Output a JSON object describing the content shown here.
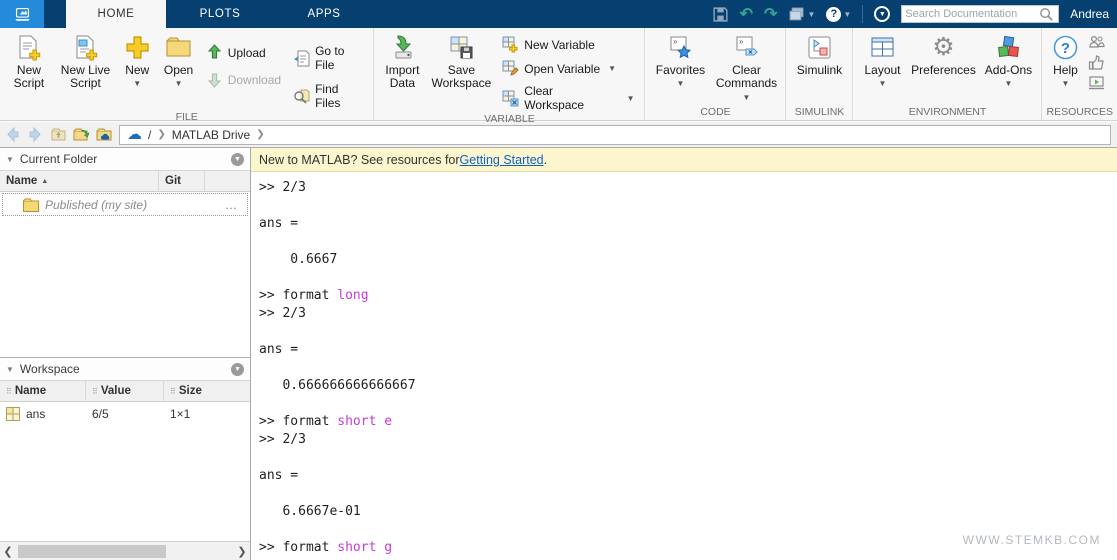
{
  "header": {
    "tabs": [
      {
        "label": "HOME"
      },
      {
        "label": "PLOTS"
      },
      {
        "label": "APPS"
      }
    ],
    "search_placeholder": "Search Documentation",
    "user_name": "Andrea"
  },
  "ribbon": {
    "file": {
      "label": "FILE",
      "new_script": "New Script",
      "new_live_script": "New Live Script",
      "new": "New",
      "open": "Open",
      "upload": "Upload",
      "download": "Download",
      "go_to_file": "Go to File",
      "find_files": "Find Files"
    },
    "variable": {
      "label": "VARIABLE",
      "import_data": "Import Data",
      "save_workspace": "Save Workspace",
      "new_variable": "New Variable",
      "open_variable": "Open Variable",
      "clear_workspace": "Clear Workspace"
    },
    "code": {
      "label": "CODE",
      "favorites": "Favorites",
      "clear_commands": "Clear Commands"
    },
    "simulink": {
      "label": "SIMULINK",
      "simulink": "Simulink"
    },
    "environment": {
      "label": "ENVIRONMENT",
      "layout": "Layout",
      "preferences": "Preferences",
      "addons": "Add-Ons"
    },
    "resources": {
      "label": "RESOURCES",
      "help": "Help"
    }
  },
  "breadcrumb": {
    "root": "/",
    "path": "MATLAB Drive"
  },
  "current_folder": {
    "title": "Current Folder",
    "col_name": "Name",
    "col_git": "Git",
    "rows": [
      {
        "name": "Published",
        "suffix": "(my site)",
        "more": "…"
      }
    ]
  },
  "workspace": {
    "title": "Workspace",
    "col_name": "Name",
    "col_value": "Value",
    "col_size": "Size",
    "rows": [
      {
        "name": "ans",
        "value": "6/5",
        "size": "1×1"
      }
    ]
  },
  "notification": {
    "text": "New to MATLAB? See resources for ",
    "link": "Getting Started",
    "period": "."
  },
  "console": {
    "lines": [
      {
        "plain": ">> 2/3"
      },
      {
        "plain": ""
      },
      {
        "plain": "ans ="
      },
      {
        "plain": ""
      },
      {
        "plain": "    0.6667"
      },
      {
        "plain": ""
      },
      {
        "pre": ">> format ",
        "kw": "long"
      },
      {
        "plain": ">> 2/3"
      },
      {
        "plain": ""
      },
      {
        "plain": "ans ="
      },
      {
        "plain": ""
      },
      {
        "plain": "   0.666666666666667"
      },
      {
        "plain": ""
      },
      {
        "pre": ">> format ",
        "kw": "short e"
      },
      {
        "plain": ">> 2/3"
      },
      {
        "plain": ""
      },
      {
        "plain": "ans ="
      },
      {
        "plain": ""
      },
      {
        "plain": "   6.6667e-01"
      },
      {
        "plain": ""
      },
      {
        "pre": ">> format ",
        "kw": "short g"
      }
    ]
  },
  "watermark": "WWW.STEMKB.COM",
  "colors": {
    "header_navy": "#064070",
    "logo_blue": "#248bda",
    "keyword_purple": "#c53cd6",
    "link_blue": "#1062c8",
    "notification_bg": "#fcf6cf",
    "folder_yellow": "#f5d876"
  }
}
